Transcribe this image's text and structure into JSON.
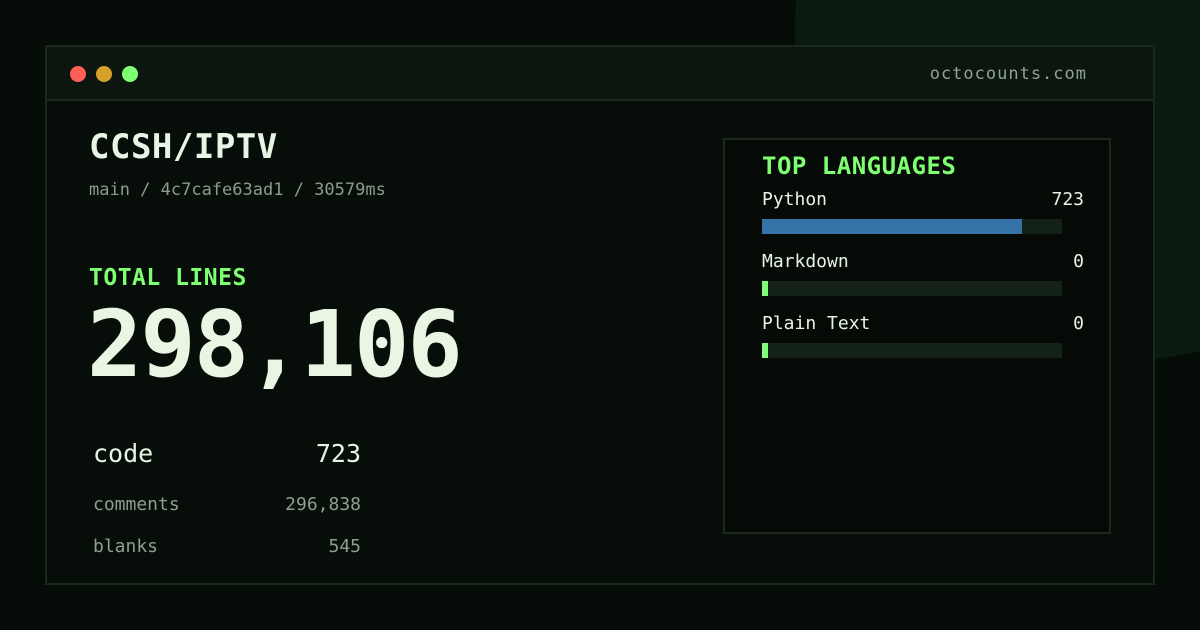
{
  "colors": {
    "accent": "#7fff72",
    "python_bar": "#3572a5",
    "dot_red": "#ff5f57",
    "dot_yellow": "#d6a12a",
    "dot_green": "#7fff72"
  },
  "window": {
    "domain": "octocounts.com"
  },
  "repo": {
    "name": "CCSH/IPTV",
    "meta": "main / 4c7cafe63ad1 / 30579ms"
  },
  "totals": {
    "label": "TOTAL LINES",
    "value": "298,106",
    "stats": [
      {
        "label": "code",
        "value": "723"
      },
      {
        "label": "comments",
        "value": "296,838"
      },
      {
        "label": "blanks",
        "value": "545"
      }
    ]
  },
  "languages": {
    "title": "TOP LANGUAGES",
    "items": [
      {
        "name": "Python",
        "count": "723",
        "fraction": 0.867,
        "color": "#3572a5"
      },
      {
        "name": "Markdown",
        "count": "0",
        "fraction": 0.02,
        "color": "#7fff72"
      },
      {
        "name": "Plain Text",
        "count": "0",
        "fraction": 0.02,
        "color": "#7fff72"
      }
    ]
  }
}
